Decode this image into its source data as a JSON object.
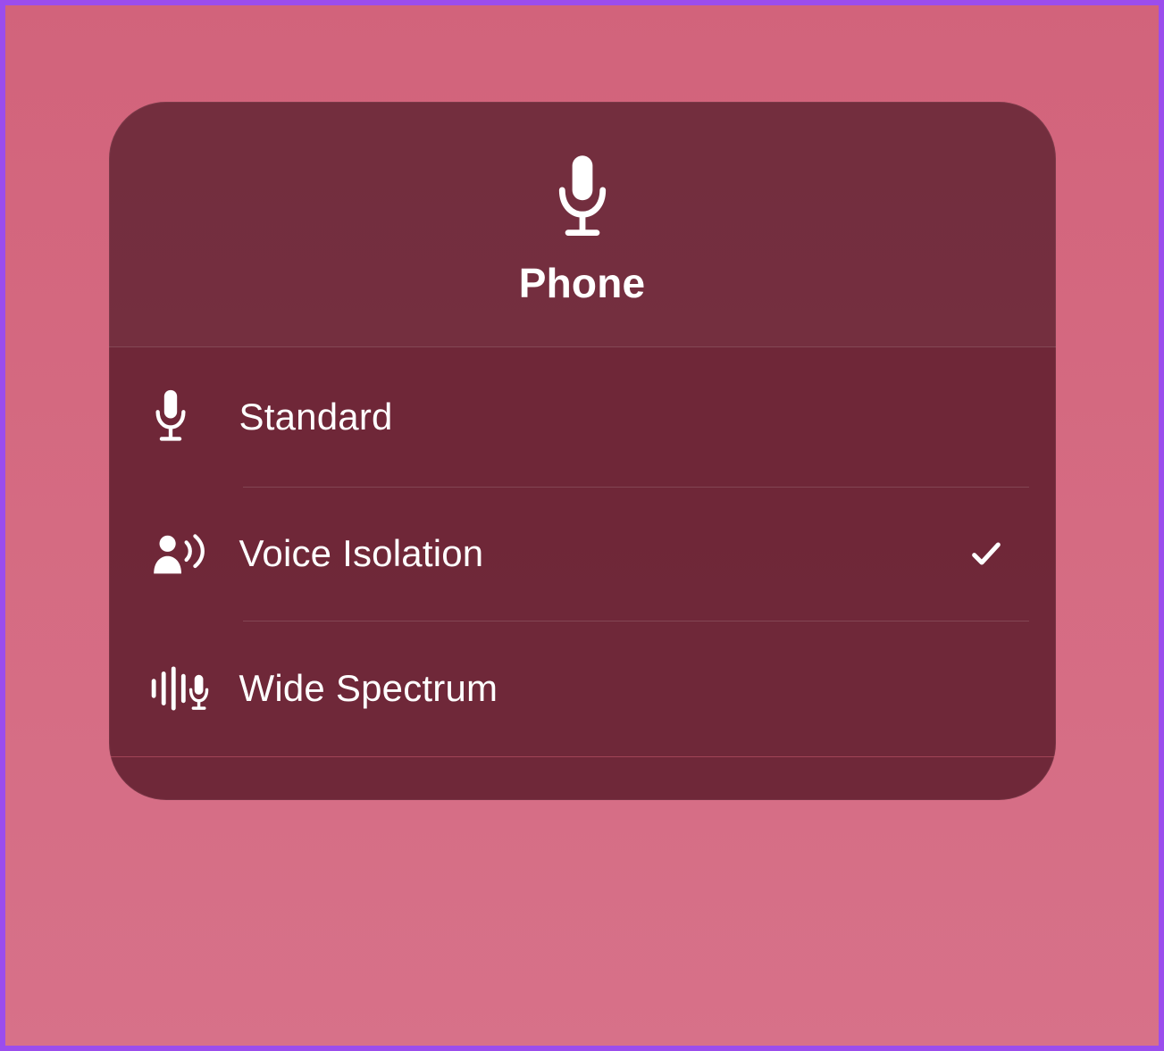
{
  "colors": {
    "accent": "#9b4ded",
    "background_top": "#d2637b",
    "background_bottom": "#d77189",
    "panel_bg": "rgba(82,20,36,0.78)",
    "text": "#ffffff"
  },
  "header": {
    "title": "Phone",
    "icon": "microphone-icon"
  },
  "options": [
    {
      "id": "standard",
      "label": "Standard",
      "icon": "microphone-icon",
      "selected": false
    },
    {
      "id": "voice-isolation",
      "label": "Voice Isolation",
      "icon": "voice-isolation-icon",
      "selected": true
    },
    {
      "id": "wide-spectrum",
      "label": "Wide Spectrum",
      "icon": "wide-spectrum-icon",
      "selected": false
    }
  ]
}
